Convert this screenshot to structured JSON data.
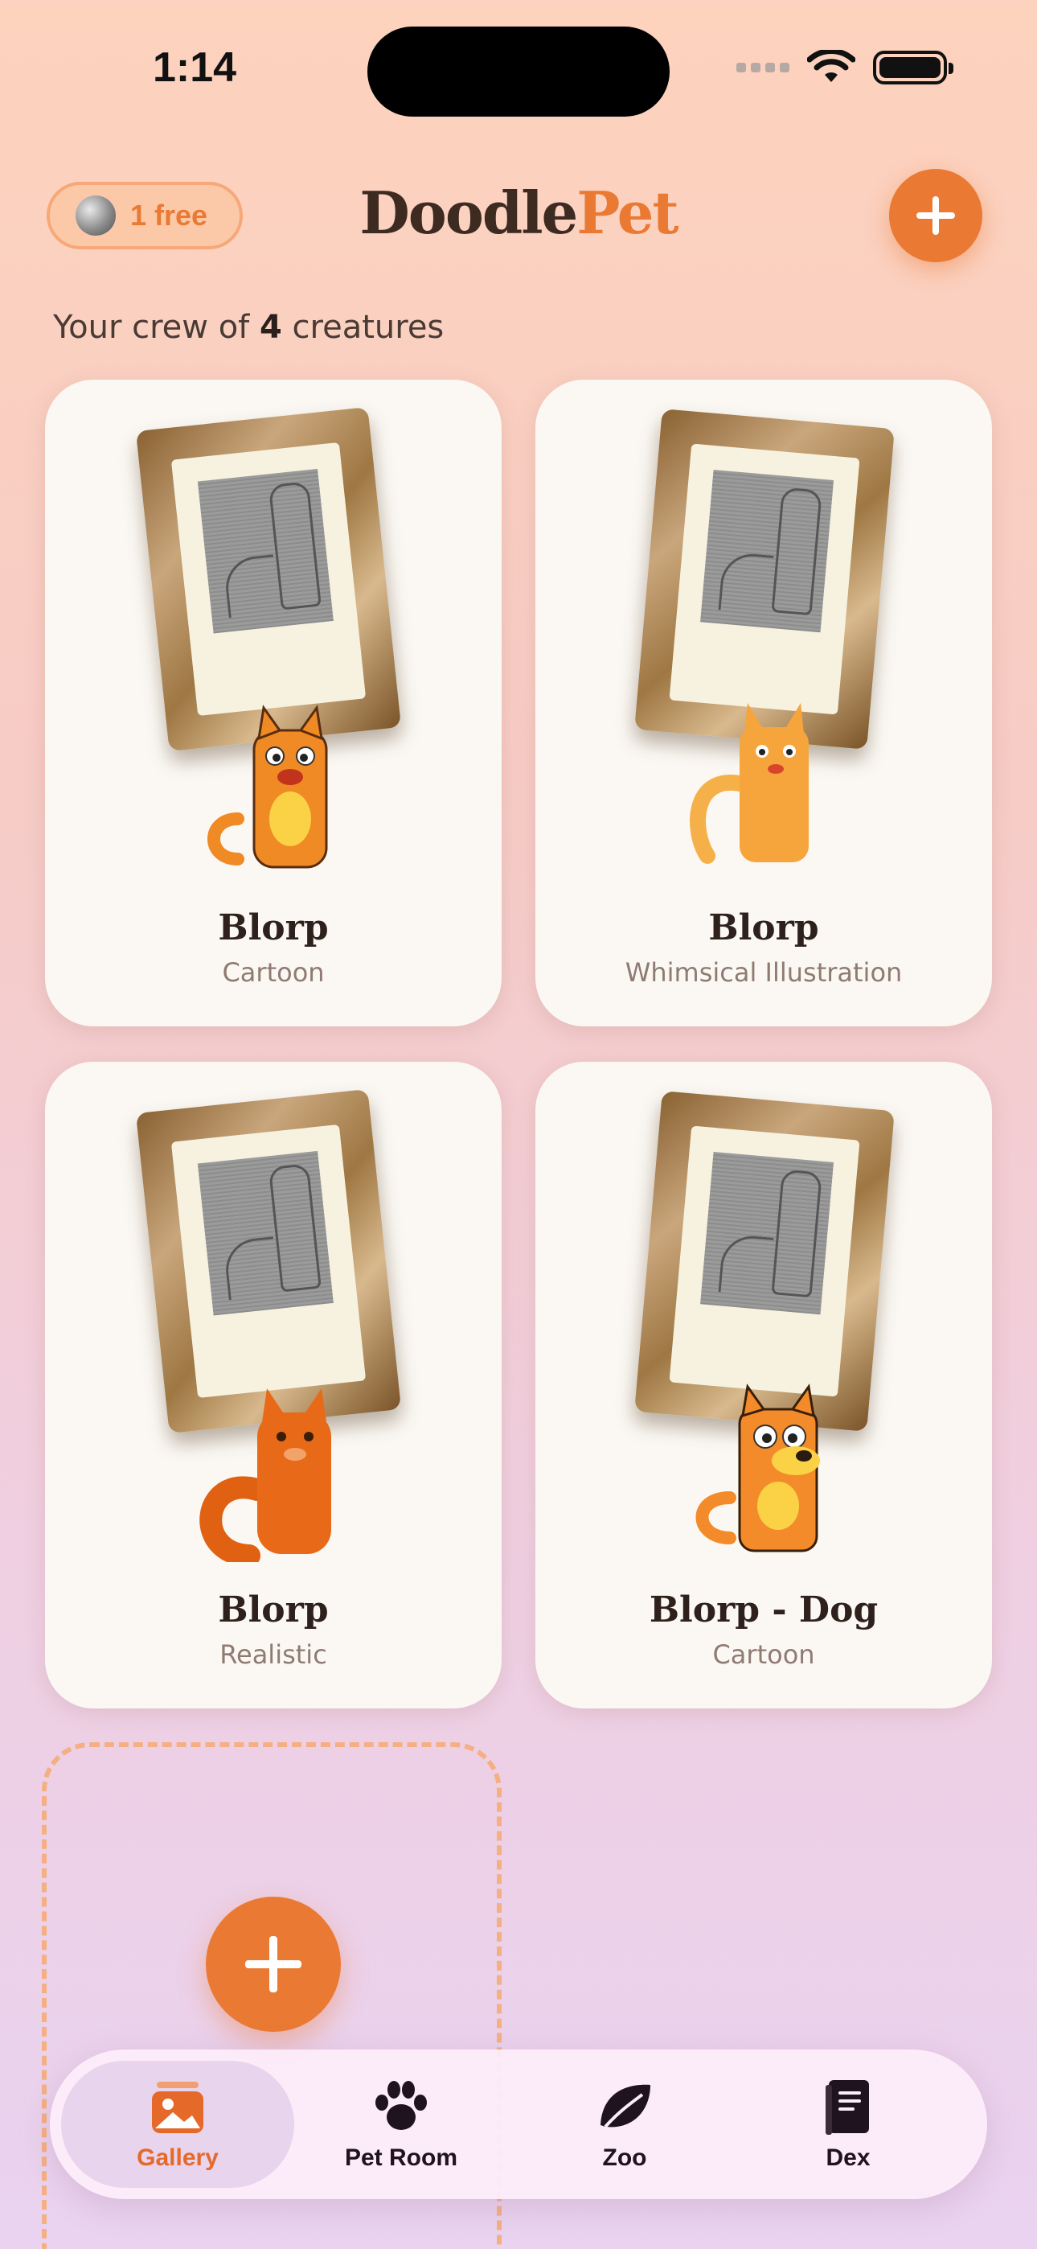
{
  "status": {
    "time": "1:14"
  },
  "header": {
    "free_label": "1 free",
    "brand_part1": "Doodle",
    "brand_part2": "Pet",
    "add_button_icon": "plus-icon"
  },
  "crew": {
    "prefix": "Your crew of ",
    "count": "4",
    "suffix": " creatures"
  },
  "cards": [
    {
      "name": "Blorp",
      "style": "Cartoon",
      "creature_color": "#f08a24"
    },
    {
      "name": "Blorp",
      "style": "Whimsical Illustration",
      "creature_color": "#f6a53c"
    },
    {
      "name": "Blorp",
      "style": "Realistic",
      "creature_color": "#e86a18"
    },
    {
      "name": "Blorp - Dog",
      "style": "Cartoon",
      "creature_color": "#f48b2b"
    }
  ],
  "tabs": [
    {
      "label": "Gallery",
      "icon": "gallery-icon",
      "active": true
    },
    {
      "label": "Pet Room",
      "icon": "paw-icon",
      "active": false
    },
    {
      "label": "Zoo",
      "icon": "leaf-icon",
      "active": false
    },
    {
      "label": "Dex",
      "icon": "book-icon",
      "active": false
    }
  ],
  "colors": {
    "accent": "#ea7a33",
    "brand_dark": "#3d2a20"
  }
}
